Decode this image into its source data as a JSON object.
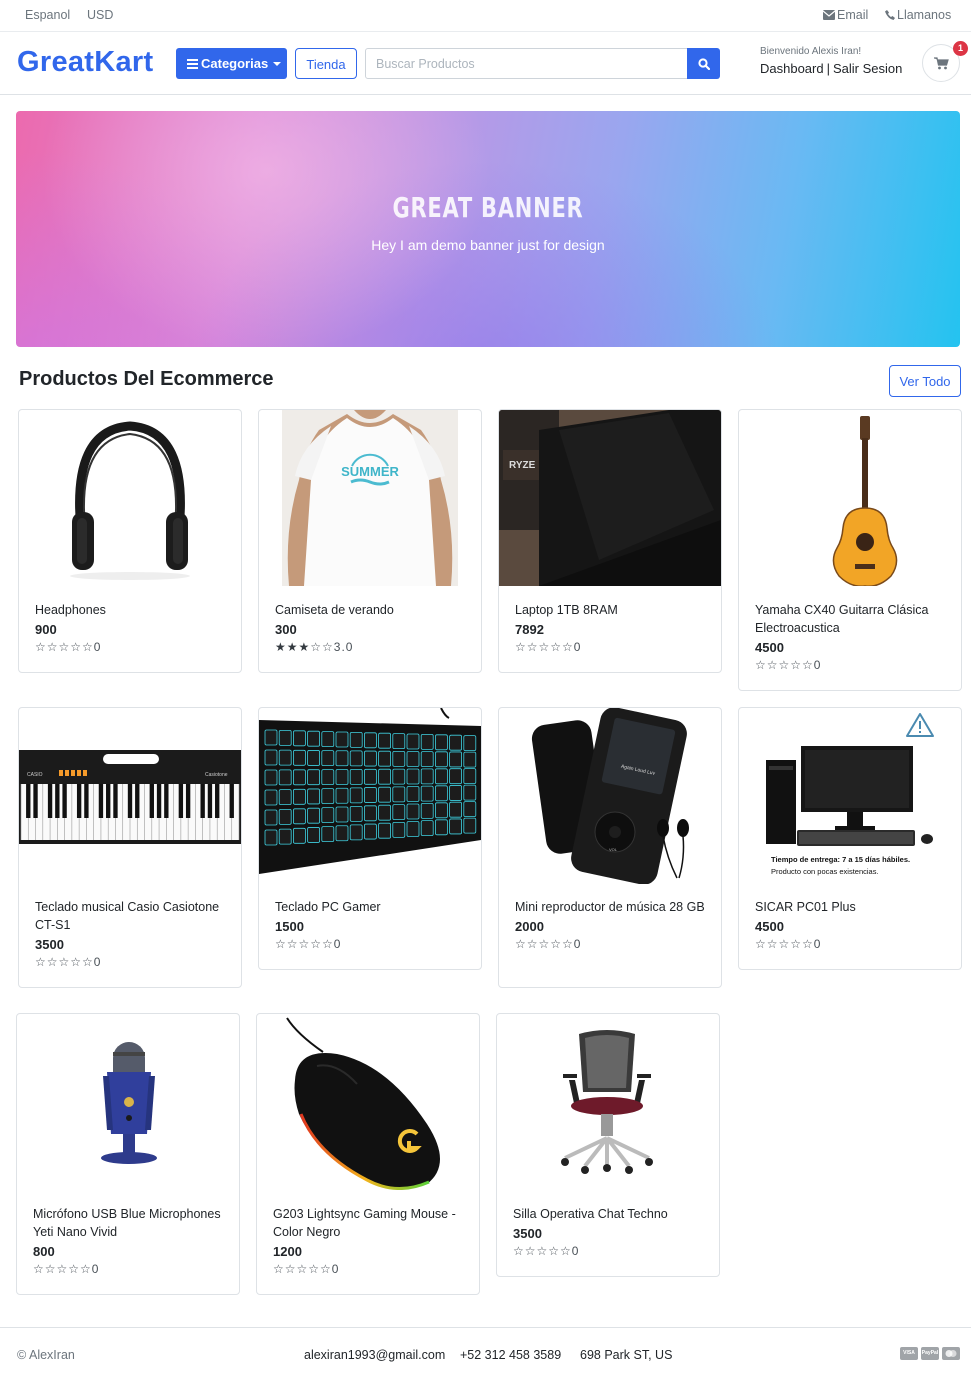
{
  "topbar": {
    "language": "Espanol",
    "currency": "USD",
    "email": "Email",
    "call": "Llamanos"
  },
  "header": {
    "logo": "GreatKart",
    "categories_label": "Categorias",
    "store_label": "Tienda",
    "search_placeholder": "Buscar Productos",
    "welcome": "Bienvenido Alexis Iran!",
    "dashboard": "Dashboard",
    "separator": "|",
    "logout": "Salir Sesion",
    "cart_count": "1"
  },
  "banner": {
    "title": "GREAT BANNER",
    "subtitle": "Hey I am demo banner just for design"
  },
  "section": {
    "title": "Productos Del Ecommerce",
    "view_all": "Ver Todo"
  },
  "products": [
    {
      "name": "Headphones",
      "price": "900",
      "rating": 0,
      "rating_label": "0",
      "icon": "headphones"
    },
    {
      "name": "Camiseta de verando",
      "price": "300",
      "rating": 3,
      "rating_label": "3.0",
      "icon": "tshirt",
      "print": "SUMMER"
    },
    {
      "name": "Laptop 1TB 8RAM",
      "price": "7892",
      "rating": 0,
      "rating_label": "0",
      "icon": "laptop",
      "sticker": "RYZE"
    },
    {
      "name": "Yamaha CX40 Guitarra Clásica Electroacustica",
      "price": "4500",
      "rating": 0,
      "rating_label": "0",
      "icon": "guitar"
    },
    {
      "name": "Teclado musical Casio Casiotone CT-S1",
      "price": "3500",
      "rating": 0,
      "rating_label": "0",
      "icon": "piano",
      "brand_left": "CASIO",
      "brand_right": "Casiotone"
    },
    {
      "name": "Teclado PC Gamer",
      "price": "1500",
      "rating": 0,
      "rating_label": "0",
      "icon": "keyboard"
    },
    {
      "name": "Mini reproductor de música 28 GB",
      "price": "2000",
      "rating": 0,
      "rating_label": "0",
      "icon": "mp3-player",
      "screen_text": "Again Loud Luv",
      "button_label": "VOL"
    },
    {
      "name": "SICAR PC01 Plus",
      "price": "4500",
      "rating": 0,
      "rating_label": "0",
      "icon": "desktop-pc",
      "notice_line1": "Tiempo de entrega: 7 a 15 días hábiles.",
      "notice_line2": "Producto con pocas existencias."
    },
    {
      "name": "Micrófono USB Blue Microphones Yeti Nano Vivid",
      "price": "800",
      "rating": 0,
      "rating_label": "0",
      "icon": "microphone"
    },
    {
      "name": "G203 Lightsync Gaming Mouse - Color Negro",
      "price": "1200",
      "rating": 0,
      "rating_label": "0",
      "icon": "mouse"
    },
    {
      "name": "Silla Operativa Chat Techno",
      "price": "3500",
      "rating": 0,
      "rating_label": "0",
      "icon": "office-chair"
    }
  ],
  "footer": {
    "copyright": "© AlexIran",
    "email": "alexiran1993@gmail.com",
    "phone": "+52 312 458 3589",
    "address": "698 Park ST, US",
    "payment_icons": [
      "visa",
      "paypal",
      "mastercard"
    ],
    "visa_label": "VISA",
    "paypal_label": "PayPal"
  },
  "colors": {
    "primary": "#3167eb",
    "badge": "#dc3545"
  }
}
